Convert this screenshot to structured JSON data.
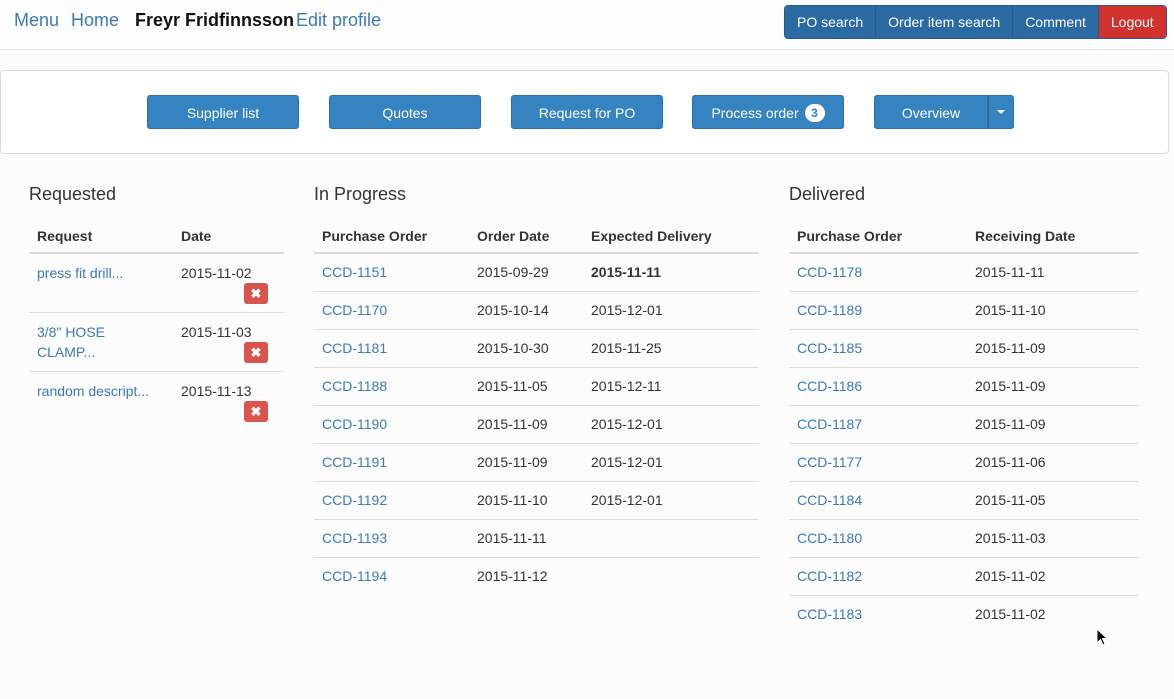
{
  "nav": {
    "menu": "Menu",
    "home": "Home",
    "user": "Freyr Fridfinnsson",
    "edit_profile": "Edit profile",
    "buttons": {
      "po_search": "PO search",
      "order_item_search": "Order item search",
      "comment": "Comment",
      "logout": "Logout"
    }
  },
  "toolbar": {
    "supplier_list": "Supplier list",
    "quotes": "Quotes",
    "request_for_po": "Request for PO",
    "process_order": "Process order",
    "process_order_count": "3",
    "overview": "Overview"
  },
  "requested": {
    "title": "Requested",
    "headers": [
      "Request",
      "Date"
    ],
    "rows": [
      {
        "request": "press fit drill...",
        "date": "2015-11-02"
      },
      {
        "request": "3/8\" HOSE CLAMP...",
        "date": "2015-11-03"
      },
      {
        "request": "random descript...",
        "date": "2015-11-13"
      }
    ],
    "delete_icon": "✖"
  },
  "in_progress": {
    "title": "In Progress",
    "headers": [
      "Purchase Order",
      "Order Date",
      "Expected Delivery"
    ],
    "rows": [
      {
        "po": "CCD-1151",
        "order_date": "2015-09-29",
        "expected": "2015-11-11",
        "expected_bold": true
      },
      {
        "po": "CCD-1170",
        "order_date": "2015-10-14",
        "expected": "2015-12-01"
      },
      {
        "po": "CCD-1181",
        "order_date": "2015-10-30",
        "expected": "2015-11-25"
      },
      {
        "po": "CCD-1188",
        "order_date": "2015-11-05",
        "expected": "2015-12-11"
      },
      {
        "po": "CCD-1190",
        "order_date": "2015-11-09",
        "expected": "2015-12-01"
      },
      {
        "po": "CCD-1191",
        "order_date": "2015-11-09",
        "expected": "2015-12-01"
      },
      {
        "po": "CCD-1192",
        "order_date": "2015-11-10",
        "expected": "2015-12-01"
      },
      {
        "po": "CCD-1193",
        "order_date": "2015-11-11",
        "expected": ""
      },
      {
        "po": "CCD-1194",
        "order_date": "2015-11-12",
        "expected": ""
      }
    ]
  },
  "delivered": {
    "title": "Delivered",
    "headers": [
      "Purchase Order",
      "Receiving Date"
    ],
    "rows": [
      {
        "po": "CCD-1178",
        "date": "2015-11-11"
      },
      {
        "po": "CCD-1189",
        "date": "2015-11-10"
      },
      {
        "po": "CCD-1185",
        "date": "2015-11-09"
      },
      {
        "po": "CCD-1186",
        "date": "2015-11-09"
      },
      {
        "po": "CCD-1187",
        "date": "2015-11-09"
      },
      {
        "po": "CCD-1177",
        "date": "2015-11-06"
      },
      {
        "po": "CCD-1184",
        "date": "2015-11-05"
      },
      {
        "po": "CCD-1180",
        "date": "2015-11-03"
      },
      {
        "po": "CCD-1182",
        "date": "2015-11-02"
      },
      {
        "po": "CCD-1183",
        "date": "2015-11-02"
      }
    ]
  }
}
